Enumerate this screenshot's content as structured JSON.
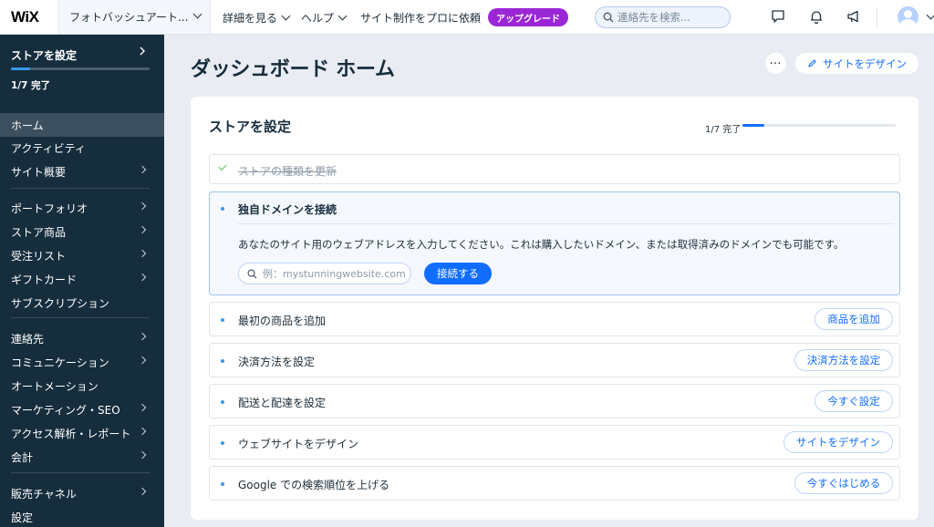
{
  "topbar": {
    "logo": "WiX",
    "site_name": "フォトバッシュアート...",
    "nav": [
      "詳細を見る",
      "ヘルプ",
      "サイト制作をプロに依頼"
    ],
    "upgrade_label": "アップグレード",
    "search_placeholder": "連絡先を検索...",
    "icons": [
      "chat-icon",
      "bell-icon",
      "megaphone-icon",
      "avatar-icon"
    ]
  },
  "sidebar": {
    "setup_label": "ストアを設定",
    "setup_progress": 0.14,
    "setup_count": "1/7 完了",
    "items": [
      {
        "label": "ホーム",
        "active": true,
        "arrow": false
      },
      {
        "label": "アクティビティ",
        "arrow": false
      },
      {
        "label": "サイト概要",
        "arrow": true
      },
      {
        "label": "ポートフォリオ",
        "arrow": true
      },
      {
        "label": "ストア商品",
        "arrow": true
      },
      {
        "label": "受注リスト",
        "arrow": true
      },
      {
        "label": "ギフトカード",
        "arrow": true
      },
      {
        "label": "サブスクリプション",
        "arrow": false
      },
      {
        "label": "連絡先",
        "arrow": true
      },
      {
        "label": "コミュニケーション",
        "arrow": true
      },
      {
        "label": "オートメーション",
        "arrow": false
      },
      {
        "label": "マーケティング・SEO",
        "arrow": true
      },
      {
        "label": "アクセス解析・レポート",
        "arrow": true
      },
      {
        "label": "会計",
        "arrow": true
      },
      {
        "label": "販売チャネル",
        "arrow": true
      },
      {
        "label": "設定",
        "arrow": false
      }
    ]
  },
  "main": {
    "title": "ダッシュボード ホーム",
    "more_label": "…",
    "design_button": "サイトをデザイン",
    "card": {
      "title": "ストアを設定",
      "progress_label": "1/7 完了",
      "progress": 0.14,
      "tasks": [
        {
          "label": "ストアの種類を更新",
          "status": "done"
        },
        {
          "label": "独自ドメインを接続",
          "status": "expanded",
          "description": "あなたのサイト用のウェブアドレスを入力してください。これは購入したいドメイン、または取得済みのドメインでも可能です。",
          "input_placeholder": "例：mystunningwebsite.com",
          "button": "接続する"
        },
        {
          "label": "最初の商品を追加",
          "button": "商品を追加"
        },
        {
          "label": "決済方法を設定",
          "button": "決済方法を設定"
        },
        {
          "label": "配送と配達を設定",
          "button": "今すぐ設定"
        },
        {
          "label": "ウェブサイトをデザイン",
          "button": "サイトをデザイン"
        },
        {
          "label": "Google での検索順位を上げる",
          "button": "今すぐはじめる"
        }
      ]
    }
  },
  "colors": {
    "sidebar_bg": "#162d3d",
    "accent": "#116dff",
    "upgrade": "#9a27d5",
    "background": "#e9ecf2"
  }
}
